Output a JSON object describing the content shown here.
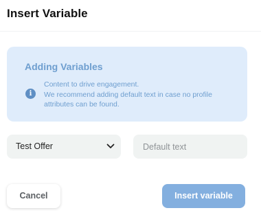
{
  "dialog": {
    "title": "Insert Variable"
  },
  "info": {
    "heading": "Adding Variables",
    "icon": "info-icon",
    "lines": [
      "Content to drive engagement.",
      "We recommend adding default text in case no profile",
      "attributes can be found."
    ]
  },
  "form": {
    "select_value": "Test Offer",
    "default_text_placeholder": "Default text",
    "default_text_value": ""
  },
  "buttons": {
    "cancel_label": "Cancel",
    "insert_label": "Insert variable"
  },
  "colors": {
    "info_background": "#dfecfb",
    "info_text": "#6e9ecf",
    "primary_button": "#83afdf",
    "field_background": "#f0f3f2"
  }
}
